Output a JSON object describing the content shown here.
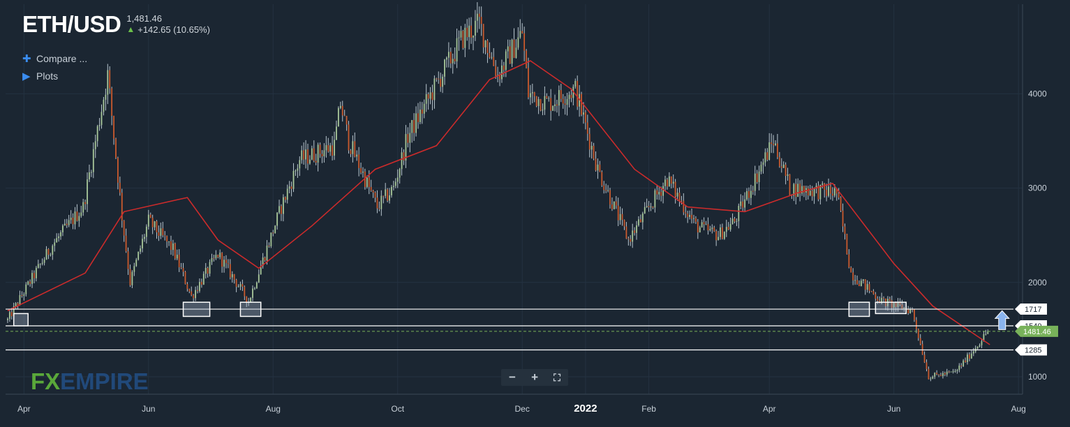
{
  "header": {
    "symbol": "ETH/USD",
    "last_price": "1,481.46",
    "change": "+142.65 (10.65%)",
    "change_direction": "up"
  },
  "menu": {
    "compare_label": "Compare ...",
    "plots_label": "Plots"
  },
  "logo": {
    "part1": "FX",
    "part2": "EMPIRE"
  },
  "colors": {
    "background": "#1b2632",
    "bull_candle": "#a8c79a",
    "bear_candle": "#c95a2e",
    "moving_average": "#cc2b2b",
    "level_line": "#ffffff",
    "last_price_tag": "#78b25a",
    "highlight_box": "#aab8cc",
    "arrow": "#8ab4ee"
  },
  "chart_data": {
    "type": "candlestick",
    "title": "ETH/USD",
    "x_tick_labels": [
      "Apr",
      "Jun",
      "Aug",
      "Oct",
      "Dec",
      "2022",
      "Feb",
      "Apr",
      "Jun",
      "Aug"
    ],
    "y_tick_labels": [
      "1000",
      "2000",
      "3000",
      "4000"
    ],
    "ylim": [
      850,
      4850
    ],
    "grid": true,
    "price_anchors": {
      "dates": [
        "2021-03-24",
        "2021-04-01",
        "2021-04-15",
        "2021-04-30",
        "2021-05-06",
        "2021-05-12",
        "2021-05-19",
        "2021-05-23",
        "2021-06-01",
        "2021-06-13",
        "2021-06-22",
        "2021-07-05",
        "2021-07-20",
        "2021-08-05",
        "2021-08-14",
        "2021-08-31",
        "2021-09-03",
        "2021-09-07",
        "2021-09-21",
        "2021-09-29",
        "2021-10-06",
        "2021-10-20",
        "2021-11-02",
        "2021-11-10",
        "2021-11-19",
        "2021-12-01",
        "2021-12-04",
        "2021-12-14",
        "2021-12-27",
        "2022-01-07",
        "2022-01-22",
        "2022-02-10",
        "2022-02-24",
        "2022-03-07",
        "2022-03-15",
        "2022-04-03",
        "2022-04-11",
        "2022-05-04",
        "2022-05-11",
        "2022-05-26",
        "2022-06-10",
        "2022-06-18",
        "2022-07-01",
        "2022-07-07",
        "2022-07-17"
      ],
      "closes": [
        1600,
        1900,
        2400,
        2800,
        3500,
        4200,
        2700,
        2000,
        2650,
        2350,
        1850,
        2300,
        1800,
        2800,
        3300,
        3450,
        3900,
        3500,
        2800,
        3000,
        3550,
        4100,
        4600,
        4750,
        4200,
        4650,
        4000,
        3900,
        4050,
        3200,
        2450,
        3100,
        2600,
        2500,
        2650,
        3500,
        3000,
        2950,
        2100,
        1800,
        1700,
        1000,
        1050,
        1200,
        1481.46
      ]
    },
    "moving_average": {
      "dates": [
        "2021-03-24",
        "2021-05-01",
        "2021-05-20",
        "2021-06-20",
        "2021-07-05",
        "2021-07-25",
        "2021-08-20",
        "2021-09-20",
        "2021-10-20",
        "2021-11-15",
        "2021-12-05",
        "2021-12-25",
        "2022-01-25",
        "2022-02-20",
        "2022-03-20",
        "2022-04-15",
        "2022-05-02",
        "2022-06-01",
        "2022-06-20",
        "2022-07-18"
      ],
      "values": [
        1700,
        2100,
        2750,
        2900,
        2450,
        2150,
        2600,
        3200,
        3450,
        4150,
        4350,
        4050,
        3200,
        2800,
        2750,
        2950,
        3050,
        2200,
        1750,
        1340
      ]
    },
    "horizontal_levels": [
      {
        "value": 1717,
        "label": "1717"
      },
      {
        "value": 1540,
        "label": "1540"
      },
      {
        "value": 1285,
        "label": "1285"
      }
    ],
    "last_price": {
      "value": 1481.46,
      "label": "1481.46"
    },
    "highlight_boxes": [
      {
        "date_start": "2021-03-27",
        "date_end": "2021-04-03",
        "high": 1670,
        "low": 1540
      },
      {
        "date_start": "2021-06-18",
        "date_end": "2021-07-01",
        "high": 1790,
        "low": 1640
      },
      {
        "date_start": "2021-07-16",
        "date_end": "2021-07-26",
        "high": 1790,
        "low": 1640
      },
      {
        "date_start": "2022-05-10",
        "date_end": "2022-05-20",
        "high": 1790,
        "low": 1640
      },
      {
        "date_start": "2022-05-23",
        "date_end": "2022-06-07",
        "high": 1790,
        "low": 1670
      }
    ],
    "breakout_arrow": {
      "date": "2022-07-24",
      "from": 1500,
      "to": 1700
    }
  }
}
